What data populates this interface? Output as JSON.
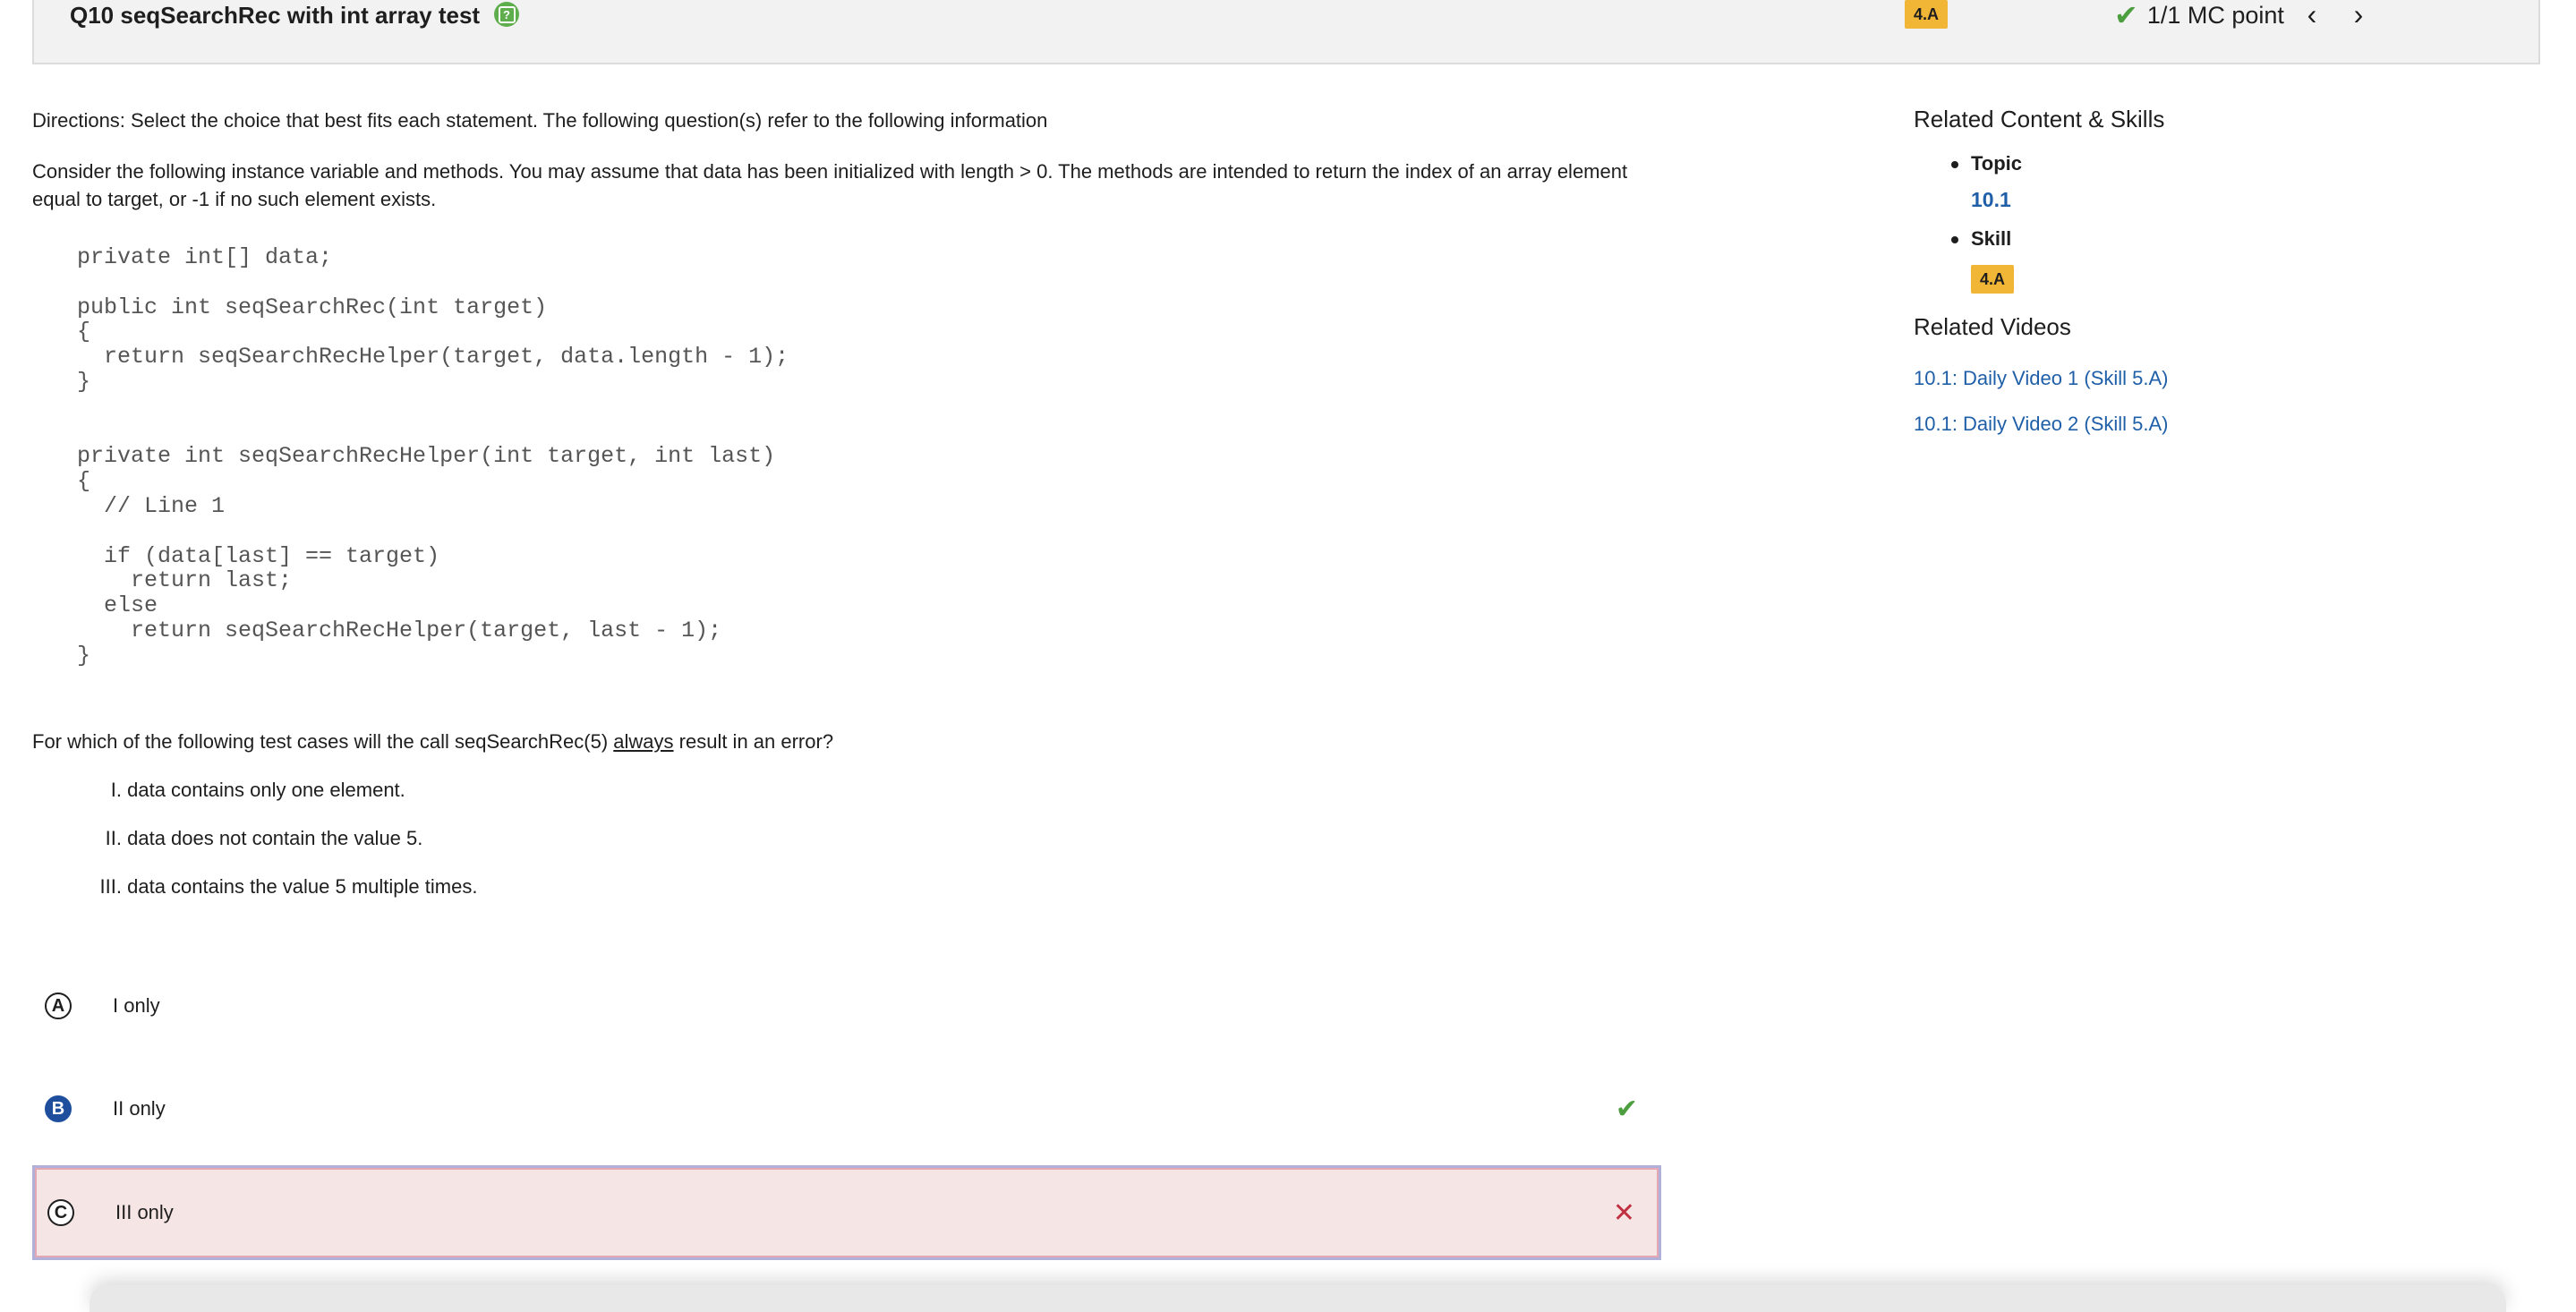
{
  "header": {
    "question_title": "Q10 seqSearchRec with int array test",
    "skill_badge": "4.A",
    "points_label": "1/1 MC point",
    "prev_arrow": "‹",
    "next_arrow": "›"
  },
  "question": {
    "directions": "Directions: Select the choice that best fits each statement. The following question(s) refer to the following information",
    "stimulus": "Consider the following instance variable and methods. You may assume that data has been initialized with length > 0. The methods are intended to return the index of an array element equal to target, or -1 if no such element exists.",
    "code": "private int[] data;\n\npublic int seqSearchRec(int target)\n{\n  return seqSearchRecHelper(target, data.length - 1);\n}\n\n\nprivate int seqSearchRecHelper(int target, int last)\n{\n  // Line 1\n\n  if (data[last] == target)\n    return last;\n  else\n    return seqSearchRecHelper(target, last - 1);\n}",
    "prompt_before": "For which of the following test cases will the call seqSearchRec(5) ",
    "prompt_emphasis": "always",
    "prompt_after": " result in an error?",
    "statements": [
      {
        "num": "I.",
        "text": "data contains only one element."
      },
      {
        "num": "II.",
        "text": "data does not contain the value 5."
      },
      {
        "num": "III.",
        "text": "data contains the value 5 multiple times."
      }
    ]
  },
  "choices": [
    {
      "letter": "A",
      "text": "I only",
      "state": "unselected"
    },
    {
      "letter": "B",
      "text": "II only",
      "state": "correct"
    },
    {
      "letter": "C",
      "text": "III only",
      "state": "incorrect"
    }
  ],
  "sidebar": {
    "related_heading": "Related Content & Skills",
    "topic_label": "Topic",
    "topic_value": "10.1",
    "skill_label": "Skill",
    "skill_value": "4.A",
    "videos_heading": "Related Videos",
    "videos": [
      "10.1: Daily Video 1 (Skill 5.A)",
      "10.1: Daily Video 2 (Skill 5.A)"
    ]
  },
  "colors": {
    "accent_blue": "#1f4f9c",
    "link_blue": "#1f5fa8",
    "badge_yellow": "#f2b636",
    "correct_green": "#4c9e3f",
    "incorrect_red": "#c03040",
    "incorrect_bg": "#f6e5e5"
  }
}
